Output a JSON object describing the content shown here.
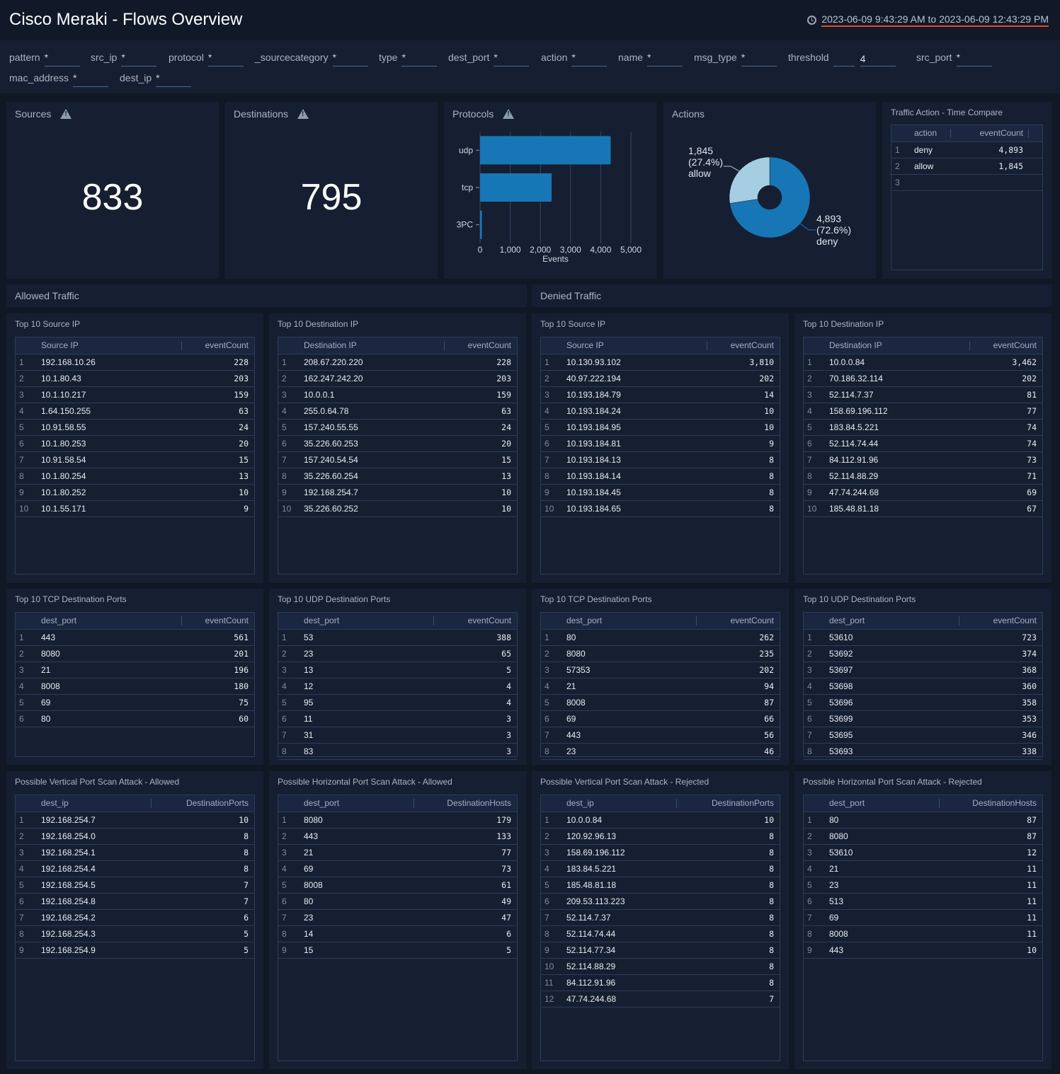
{
  "header": {
    "title": "Cisco Meraki - Flows Overview",
    "time_range": "2023-06-09 9:43:29 AM to 2023-06-09 12:43:29 PM"
  },
  "filters": [
    {
      "label": "pattern",
      "value": "*"
    },
    {
      "label": "src_ip",
      "value": "*"
    },
    {
      "label": "protocol",
      "value": "*"
    },
    {
      "label": "_sourcecategory",
      "value": "*"
    },
    {
      "label": "type",
      "value": "*"
    },
    {
      "label": "dest_port",
      "value": "*"
    },
    {
      "label": "action",
      "value": "*"
    },
    {
      "label": "name",
      "value": "*"
    },
    {
      "label": "msg_type",
      "value": "*"
    },
    {
      "label": "threshold",
      "value": "",
      "value2": "4"
    },
    {
      "label": "src_port",
      "value": "*"
    },
    {
      "label": "mac_address",
      "value": "*"
    },
    {
      "label": "dest_ip",
      "value": "*"
    }
  ],
  "sources": {
    "title": "Sources",
    "value": "833"
  },
  "destinations": {
    "title": "Destinations",
    "value": "795"
  },
  "protocols": {
    "title": "Protocols"
  },
  "actions": {
    "title": "Actions"
  },
  "traffic_compare": {
    "title": "Traffic Action - Time Compare",
    "columns": [
      "action",
      "eventCount"
    ],
    "rows": [
      [
        "deny",
        "4,893"
      ],
      [
        "allow",
        "1,845"
      ],
      [
        "",
        ""
      ]
    ]
  },
  "chart_data": [
    {
      "type": "bar",
      "orientation": "horizontal",
      "title": "Protocols",
      "categories": [
        "udp",
        "tcp",
        "3PC"
      ],
      "values": [
        4330,
        2370,
        60
      ],
      "xlabel": "Events",
      "ylabel": "",
      "xlim": [
        0,
        5000
      ],
      "ticks": [
        "0",
        "1,000",
        "2,000",
        "3,000",
        "4,000",
        "5,000"
      ],
      "grid": true,
      "color": "#1777b6"
    },
    {
      "type": "pie",
      "title": "Actions",
      "donut": true,
      "categories": [
        "deny",
        "allow"
      ],
      "values": [
        4893,
        1845
      ],
      "percents": [
        "72.6%",
        "27.4%"
      ],
      "labels": [
        [
          "4,893",
          "(72.6%)",
          "deny"
        ],
        [
          "1,845",
          "(27.4%)",
          "allow"
        ]
      ],
      "colors": [
        "#1777b6",
        "#a6cee3"
      ]
    }
  ],
  "sections": {
    "allowed": "Allowed Traffic",
    "denied": "Denied Traffic"
  },
  "tables": {
    "allowed_src": {
      "title": "Top 10 Source IP",
      "columns": [
        "Source IP",
        "eventCount"
      ],
      "rows": [
        [
          "192.168.10.26",
          "228"
        ],
        [
          "10.1.80.43",
          "203"
        ],
        [
          "10.1.10.217",
          "159"
        ],
        [
          "1.64.150.255",
          "63"
        ],
        [
          "10.91.58.55",
          "24"
        ],
        [
          "10.1.80.253",
          "20"
        ],
        [
          "10.91.58.54",
          "15"
        ],
        [
          "10.1.80.254",
          "13"
        ],
        [
          "10.1.80.252",
          "10"
        ],
        [
          "10.1.55.171",
          "9"
        ]
      ]
    },
    "allowed_dst": {
      "title": "Top 10 Destination IP",
      "columns": [
        "Destination IP",
        "eventCount"
      ],
      "rows": [
        [
          "208.67.220.220",
          "228"
        ],
        [
          "162.247.242.20",
          "203"
        ],
        [
          "10.0.0.1",
          "159"
        ],
        [
          "255.0.64.78",
          "63"
        ],
        [
          "157.240.55.55",
          "24"
        ],
        [
          "35.226.60.253",
          "20"
        ],
        [
          "157.240.54.54",
          "15"
        ],
        [
          "35.226.60.254",
          "13"
        ],
        [
          "192.168.254.7",
          "10"
        ],
        [
          "35.226.60.252",
          "10"
        ]
      ]
    },
    "denied_src": {
      "title": "Top 10 Source IP",
      "columns": [
        "Source IP",
        "eventCount"
      ],
      "rows": [
        [
          "10.130.93.102",
          "3,810"
        ],
        [
          "40.97.222.194",
          "202"
        ],
        [
          "10.193.184.79",
          "14"
        ],
        [
          "10.193.184.24",
          "10"
        ],
        [
          "10.193.184.95",
          "10"
        ],
        [
          "10.193.184.81",
          "9"
        ],
        [
          "10.193.184.13",
          "8"
        ],
        [
          "10.193.184.14",
          "8"
        ],
        [
          "10.193.184.45",
          "8"
        ],
        [
          "10.193.184.65",
          "8"
        ]
      ]
    },
    "denied_dst": {
      "title": "Top 10 Destination IP",
      "columns": [
        "Destination IP",
        "eventCount"
      ],
      "rows": [
        [
          "10.0.0.84",
          "3,462"
        ],
        [
          "70.186.32.114",
          "202"
        ],
        [
          "52.114.7.37",
          "81"
        ],
        [
          "158.69.196.112",
          "77"
        ],
        [
          "183.84.5.221",
          "74"
        ],
        [
          "52.114.74.44",
          "74"
        ],
        [
          "84.112.91.96",
          "73"
        ],
        [
          "52.114.88.29",
          "71"
        ],
        [
          "47.74.244.68",
          "69"
        ],
        [
          "185.48.81.18",
          "67"
        ]
      ]
    },
    "allowed_tcp": {
      "title": "Top 10 TCP Destination Ports",
      "columns": [
        "dest_port",
        "eventCount"
      ],
      "rows": [
        [
          "443",
          "561"
        ],
        [
          "8080",
          "201"
        ],
        [
          "21",
          "196"
        ],
        [
          "8008",
          "180"
        ],
        [
          "69",
          "75"
        ],
        [
          "80",
          "60"
        ]
      ]
    },
    "allowed_udp": {
      "title": "Top 10 UDP Destination Ports",
      "columns": [
        "dest_port",
        "eventCount"
      ],
      "rows": [
        [
          "53",
          "388"
        ],
        [
          "23",
          "65"
        ],
        [
          "13",
          "5"
        ],
        [
          "12",
          "4"
        ],
        [
          "95",
          "4"
        ],
        [
          "11",
          "3"
        ],
        [
          "31",
          "3"
        ],
        [
          "83",
          "3"
        ]
      ]
    },
    "denied_tcp": {
      "title": "Top 10 TCP Destination Ports",
      "columns": [
        "dest_port",
        "eventCount"
      ],
      "rows": [
        [
          "80",
          "262"
        ],
        [
          "8080",
          "235"
        ],
        [
          "57353",
          "202"
        ],
        [
          "21",
          "94"
        ],
        [
          "8008",
          "87"
        ],
        [
          "69",
          "66"
        ],
        [
          "443",
          "56"
        ],
        [
          "23",
          "46"
        ]
      ]
    },
    "denied_udp": {
      "title": "Top 10 UDP Destination Ports",
      "columns": [
        "dest_port",
        "eventCount"
      ],
      "rows": [
        [
          "53610",
          "723"
        ],
        [
          "53692",
          "374"
        ],
        [
          "53697",
          "368"
        ],
        [
          "53698",
          "360"
        ],
        [
          "53696",
          "358"
        ],
        [
          "53699",
          "353"
        ],
        [
          "53695",
          "346"
        ],
        [
          "53693",
          "338"
        ]
      ]
    },
    "vscan_allowed": {
      "title": "Possible Vertical Port Scan Attack - Allowed",
      "columns": [
        "dest_ip",
        "DestinationPorts"
      ],
      "rows": [
        [
          "192.168.254.7",
          "10"
        ],
        [
          "192.168.254.0",
          "8"
        ],
        [
          "192.168.254.1",
          "8"
        ],
        [
          "192.168.254.4",
          "8"
        ],
        [
          "192.168.254.5",
          "7"
        ],
        [
          "192.168.254.8",
          "7"
        ],
        [
          "192.168.254.2",
          "6"
        ],
        [
          "192.168.254.3",
          "5"
        ],
        [
          "192.168.254.9",
          "5"
        ]
      ]
    },
    "hscan_allowed": {
      "title": "Possible Horizontal Port Scan Attack - Allowed",
      "columns": [
        "dest_port",
        "DestinationHosts"
      ],
      "rows": [
        [
          "8080",
          "179"
        ],
        [
          "443",
          "133"
        ],
        [
          "21",
          "77"
        ],
        [
          "69",
          "73"
        ],
        [
          "8008",
          "61"
        ],
        [
          "80",
          "49"
        ],
        [
          "23",
          "47"
        ],
        [
          "14",
          "6"
        ],
        [
          "15",
          "5"
        ]
      ]
    },
    "vscan_rejected": {
      "title": "Possible Vertical Port Scan Attack - Rejected",
      "columns": [
        "dest_ip",
        "DestinationPorts"
      ],
      "rows": [
        [
          "10.0.0.84",
          "10"
        ],
        [
          "120.92.96.13",
          "8"
        ],
        [
          "158.69.196.112",
          "8"
        ],
        [
          "183.84.5.221",
          "8"
        ],
        [
          "185.48.81.18",
          "8"
        ],
        [
          "209.53.113.223",
          "8"
        ],
        [
          "52.114.7.37",
          "8"
        ],
        [
          "52.114.74.44",
          "8"
        ],
        [
          "52.114.77.34",
          "8"
        ],
        [
          "52.114.88.29",
          "8"
        ],
        [
          "84.112.91.96",
          "8"
        ],
        [
          "47.74.244.68",
          "7"
        ]
      ]
    },
    "hscan_rejected": {
      "title": "Possible Horizontal Port Scan Attack - Rejected",
      "columns": [
        "dest_port",
        "DestinationHosts"
      ],
      "rows": [
        [
          "80",
          "87"
        ],
        [
          "8080",
          "87"
        ],
        [
          "53610",
          "12"
        ],
        [
          "21",
          "11"
        ],
        [
          "23",
          "11"
        ],
        [
          "513",
          "11"
        ],
        [
          "69",
          "11"
        ],
        [
          "8008",
          "11"
        ],
        [
          "443",
          "10"
        ]
      ]
    }
  }
}
